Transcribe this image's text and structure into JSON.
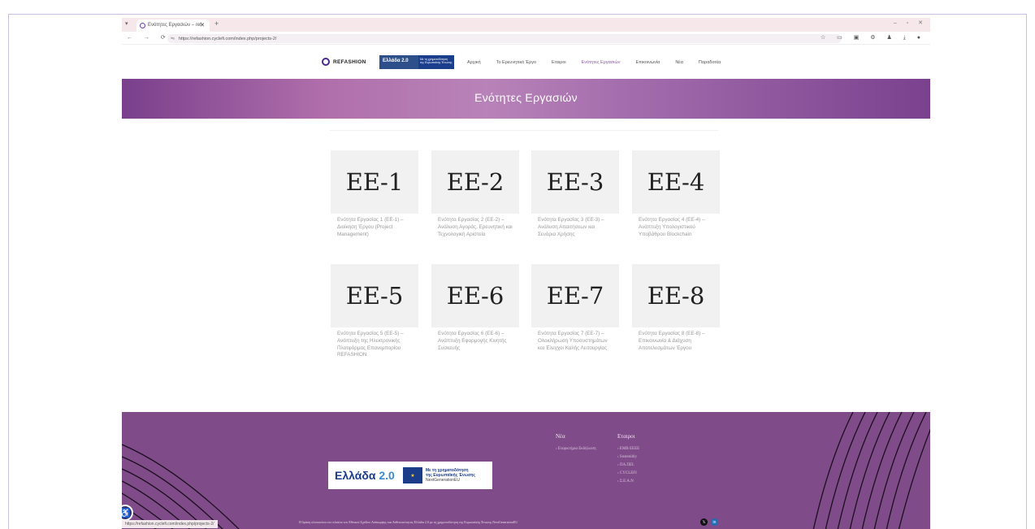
{
  "browser": {
    "tab_title": "Ενότητες Εργασιών – ref",
    "url": "https://refashion.cyclefi.com/index.php/projects-2/",
    "status_url": "https://refashion.cyclefi.com/index.php/projects-2/"
  },
  "site": {
    "logo_text": "REFASHION",
    "ellada_small_label": "Ελλάδα 2.0",
    "ellada_small_sub": "Με τη χρηματοδότηση της Ευρωπαϊκής Ένωσης"
  },
  "menu": [
    {
      "label": "Αρχική"
    },
    {
      "label": "Το Ερευνητικό Έργο"
    },
    {
      "label": "Εταιροι"
    },
    {
      "label": "Ενότητες Εργασιών"
    },
    {
      "label": "Επικοινωνία"
    },
    {
      "label": "Νέα"
    },
    {
      "label": "Παραδοτέα"
    }
  ],
  "hero": {
    "title": "Ενότητες Εργασιών"
  },
  "cards": [
    {
      "code": "ΕΕ-1",
      "desc": "Ενότητα Εργασίας 1 (ΕΕ-1) – Διοίκηση Έργου (Project Management)"
    },
    {
      "code": "ΕΕ-2",
      "desc": "Ενότητα Εργασίας 2 (ΕΕ-2) – Ανάλυση Αγοράς, Ερευνητική και Τεχνολογική Αριστεία"
    },
    {
      "code": "ΕΕ-3",
      "desc": "Ενότητα Εργασίας 3 (ΕΕ-3) – Ανάλυση Απαιτήσεων και Σενάρια Χρήσης"
    },
    {
      "code": "ΕΕ-4",
      "desc": "Ενότητα Εργασίας 4 (ΕΕ-4) – Ανάπτυξη Υπολογιστικού Υποβάθρου Blockchain"
    },
    {
      "code": "ΕΕ-5",
      "desc": "Ενότητα Εργασίας 5 (ΕΕ-5) – Ανάπτυξη της Ηλεκτρονικής Πλατφόρμας Επανεμπορίου REFASHION"
    },
    {
      "code": "ΕΕ-6",
      "desc": "Ενότητα Εργασίας 6 (ΕΕ-6) – Ανάπτυξη Εφαρμογής Κινητής Συσκευής"
    },
    {
      "code": "ΕΕ-7",
      "desc": "Ενότητα Εργασίας 7 (ΕΕ-7) – Ολοκλήρωση Υποσυστημάτων και Έλεγχοι Καλής Λειτουργίας"
    },
    {
      "code": "ΕΕ-8",
      "desc": "Ενότητα Εργασίας 8 (ΕΕ-8) – Επικοινωνία & Διάχυση Αποτελεσμάτων Έργου"
    }
  ],
  "footer": {
    "ellada_big_main": "Ελλάδα",
    "ellada_big_num": "2.0",
    "eu_line1": "Με τη χρηματοδότηση",
    "eu_line2": "της Ευρωπαϊκής Ένωσης",
    "eu_line3": "NextGenerationEU",
    "news_title": "Νέα",
    "news_items": [
      "Εναρκτήρια Εκδήλωση"
    ],
    "partners_title": "Εταιροι",
    "partners": [
      "EMB EEEE",
      "Sostenibly",
      "ΠΑ.ΠΕΙ.",
      "CYCLEFI",
      "Σ.Ε.Α.Ν"
    ],
    "note": "Η δράση υλοποιείται στο πλαίσιο του Εθνικού Σχεδίου Ανάκαμψης και Ανθεκτικότητας Ελλάδα 2.0 με τη χρηματοδότηση της Ευρωπαϊκής Ένωσης NextGenerationEU"
  },
  "colors": {
    "footer_bg": "#7f4b88",
    "hero_gradient_start": "#7a3f8c",
    "active_menu": "#8a5aa8"
  }
}
